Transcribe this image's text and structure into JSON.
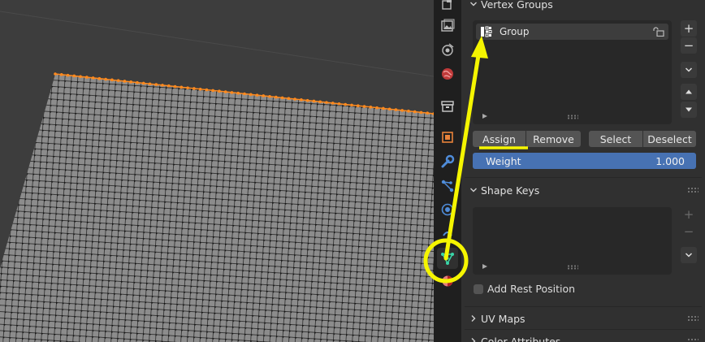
{
  "vertex_groups": {
    "title": "Vertex Groups",
    "items": [
      {
        "name": "Group"
      }
    ],
    "buttons": {
      "assign": "Assign",
      "remove": "Remove",
      "select": "Select",
      "deselect": "Deselect"
    },
    "weight": {
      "label": "Weight",
      "value": "1.000"
    }
  },
  "shape_keys": {
    "title": "Shape Keys",
    "add_rest_position_label": "Add Rest Position",
    "add_rest_position_checked": false
  },
  "uv_maps": {
    "title": "UV Maps"
  },
  "color_attributes": {
    "title": "Color Attributes"
  },
  "tabs": [
    {
      "icon": "tool-icon"
    },
    {
      "icon": "render-icon"
    },
    {
      "icon": "output-icon"
    },
    {
      "icon": "view-layer-icon"
    },
    {
      "icon": "scene-icon"
    },
    {
      "icon": "world-icon"
    },
    {
      "icon": "collection-icon"
    },
    {
      "icon": "object-icon"
    },
    {
      "icon": "modifier-icon"
    },
    {
      "icon": "particles-icon"
    },
    {
      "icon": "physics-icon"
    },
    {
      "icon": "constraints-icon"
    },
    {
      "icon": "object-data-icon",
      "active": true
    },
    {
      "icon": "material-icon"
    }
  ],
  "colors": {
    "accent_blue": "#4772b3",
    "annotation_yellow": "#f5f500",
    "mesh_face": "#8c8c8c",
    "mesh_edge": "#1a1a1a",
    "selected_vertex": "#ff8a1e",
    "data_tab_green": "#3ad6a8",
    "panel_bg": "#303030",
    "tab_bar_bg": "#1f1f1f"
  }
}
